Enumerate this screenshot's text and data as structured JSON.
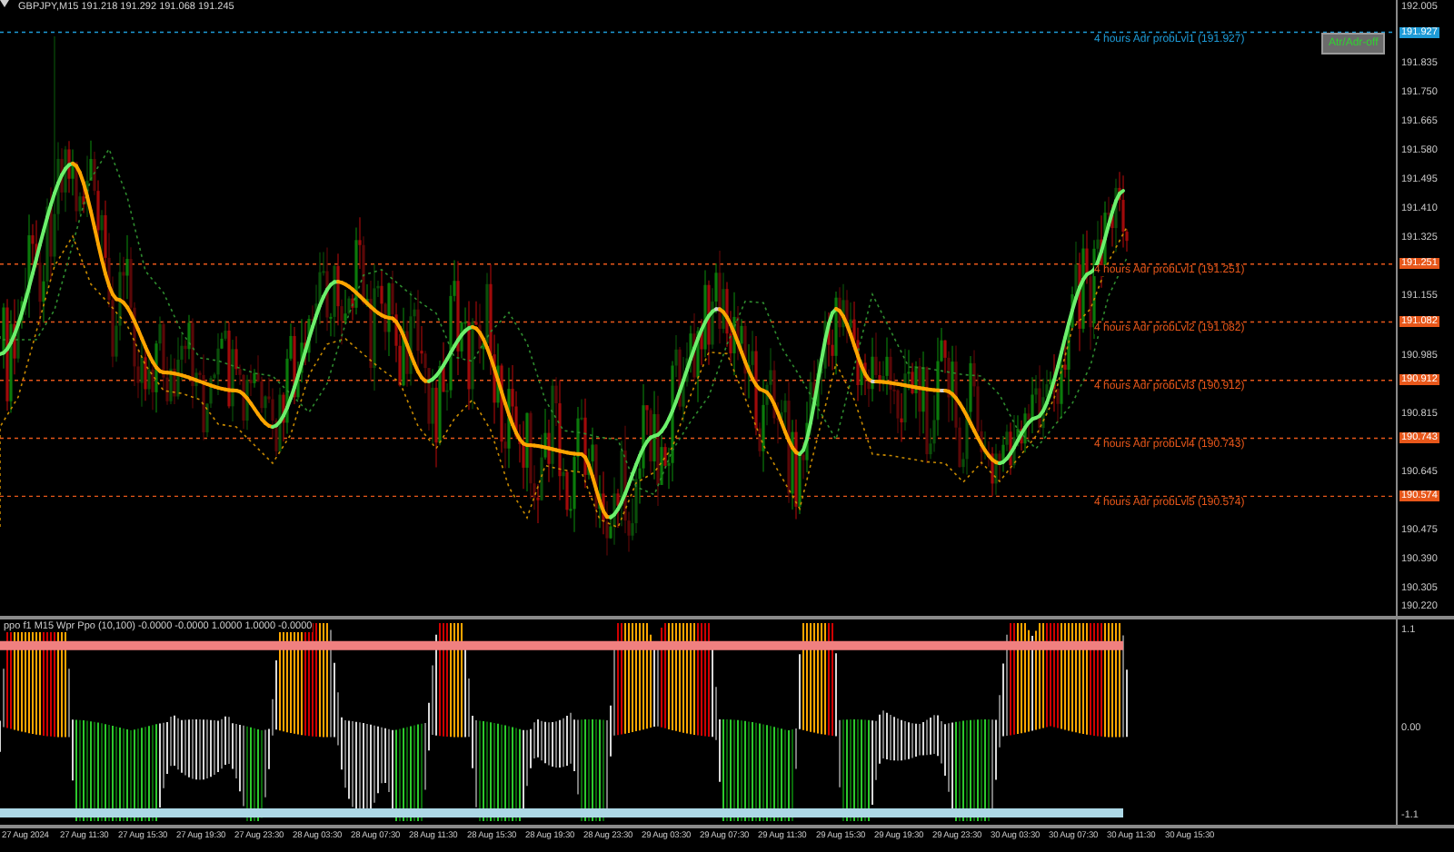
{
  "chart_header": "GBPJPY,M15  191.218 191.292 191.068 191.245",
  "toggle_button": {
    "label": "Atr/Adr-off"
  },
  "price_axis": [
    "192.005",
    "191.835",
    "191.750",
    "191.665",
    "191.580",
    "191.495",
    "191.410",
    "191.325",
    "191.155",
    "190.985",
    "190.815",
    "190.645",
    "190.475",
    "190.390",
    "190.305",
    "190.220"
  ],
  "levels": [
    {
      "label": "4 hours Adr probLvl1 (191.927)",
      "price_tag": "191.927",
      "color": "#1e9bd7"
    },
    {
      "label": "4 hours Adr probLvl1 (191.251)",
      "price_tag": "191.251",
      "color": "#e8571a"
    },
    {
      "label": "4 hours Adr probLvl2 (191.082)",
      "price_tag": "191.082",
      "color": "#e8571a"
    },
    {
      "label": "4 hours Adr probLvl3 (190.912)",
      "price_tag": "190.912",
      "color": "#e8571a"
    },
    {
      "label": "4 hours Adr probLvl4 (190.743)",
      "price_tag": "190.743",
      "color": "#e8571a"
    },
    {
      "label": "4 hours Adr probLvl5 (190.574)",
      "price_tag": "190.574",
      "color": "#e8571a"
    }
  ],
  "indicator": {
    "header": "ppo f1 M15 Wpr Ppo (10,100) -0.0000 -0.0000 1.0000 1.0000 -0.0000",
    "axis": [
      "1.1",
      "0.00",
      "-1.1"
    ]
  },
  "time_axis": [
    "27 Aug 2024",
    "27 Aug 11:30",
    "27 Aug 15:30",
    "27 Aug 19:30",
    "27 Aug 23:30",
    "28 Aug 03:30",
    "28 Aug 07:30",
    "28 Aug 11:30",
    "28 Aug 15:30",
    "28 Aug 19:30",
    "28 Aug 23:30",
    "29 Aug 03:30",
    "29 Aug 07:30",
    "29 Aug 11:30",
    "29 Aug 15:30",
    "29 Aug 19:30",
    "29 Aug 23:30",
    "30 Aug 03:30",
    "30 Aug 07:30",
    "30 Aug 11:30",
    "30 Aug 15:30"
  ]
}
